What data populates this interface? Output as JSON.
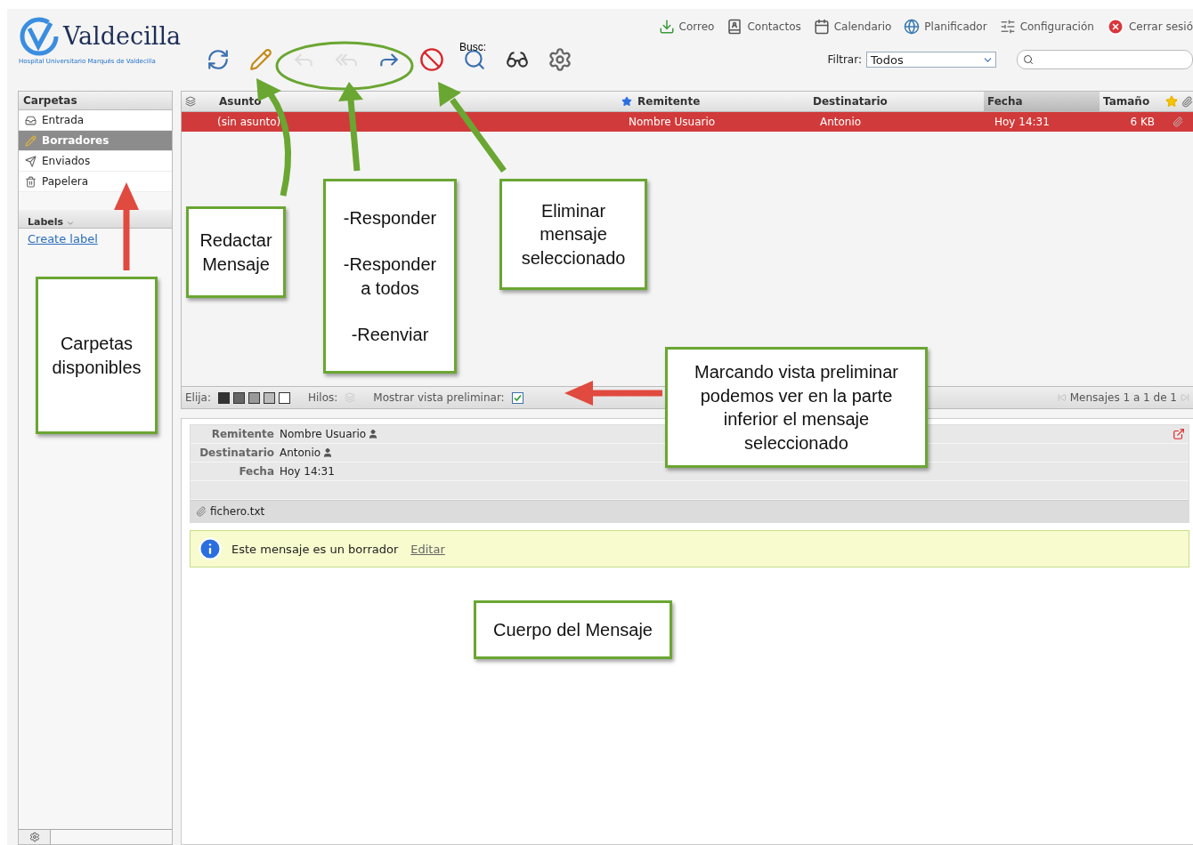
{
  "logo": {
    "name": "Valdecilla",
    "subtitle": "Hospital Universitario Marqués de Valdecilla"
  },
  "top_nav": [
    {
      "label": "Correo",
      "kind": "mail"
    },
    {
      "label": "Contactos",
      "kind": "contacts"
    },
    {
      "label": "Calendario",
      "kind": "calendar"
    },
    {
      "label": "Planificador",
      "kind": "planner"
    },
    {
      "label": "Configuración",
      "kind": "settings"
    },
    {
      "label": "Cerrar sesió",
      "kind": "logout"
    }
  ],
  "toolbar": {
    "buttons": [
      {
        "kind": "refresh",
        "disabled": false
      },
      {
        "kind": "compose",
        "disabled": false
      },
      {
        "kind": "reply",
        "disabled": true
      },
      {
        "kind": "reply_all",
        "disabled": true
      },
      {
        "kind": "forward",
        "disabled": false
      },
      {
        "kind": "delete",
        "disabled": false
      },
      {
        "kind": "search",
        "disabled": false,
        "label": "Busc:"
      },
      {
        "kind": "mark",
        "disabled": false
      },
      {
        "kind": "more",
        "disabled": false
      }
    ],
    "filter_label": "Filtrar:",
    "filter_value": "Todos"
  },
  "folders": {
    "title": "Carpetas",
    "items": [
      {
        "label": "Entrada",
        "kind": "inbox",
        "selected": false
      },
      {
        "label": "Borradores",
        "kind": "drafts",
        "selected": true
      },
      {
        "label": "Enviados",
        "kind": "sent",
        "selected": false
      },
      {
        "label": "Papelera",
        "kind": "trash",
        "selected": false
      }
    ]
  },
  "labels": {
    "title": "Labels",
    "link": "Create label"
  },
  "message_list": {
    "columns": [
      {
        "label": "Asunto",
        "sorted": false
      },
      {
        "label": "Remitente",
        "sorted": false
      },
      {
        "label": "Destinatario",
        "sorted": false
      },
      {
        "label": "Fecha",
        "sorted": true
      },
      {
        "label": "Tamaño",
        "sorted": false
      }
    ],
    "rows": [
      {
        "subject": "(sin asunto)",
        "from": "Nombre Usuario",
        "to": "Antonio",
        "date": "Hoy 14:31",
        "size": "6 KB",
        "selected": true
      }
    ]
  },
  "list_footer": {
    "select_label": "Elija:",
    "threads_label": "Hilos:",
    "preview_label": "Mostrar vista preliminar:",
    "preview_checked": true,
    "pager": "Mensajes 1 a 1 de 1"
  },
  "preview": {
    "headers": [
      {
        "label": "Remitente",
        "value": "Nombre Usuario",
        "contact": true
      },
      {
        "label": "Destinatario",
        "value": "Antonio",
        "contact": true
      },
      {
        "label": "Fecha",
        "value": "Hoy 14:31",
        "contact": false
      }
    ],
    "attachment": "fichero.txt",
    "notice": "Este mensaje es un borrador",
    "notice_link": "Editar"
  },
  "annotations": [
    {
      "paragraphs": [
        [
          "Carpetas",
          "disponibles"
        ]
      ]
    },
    {
      "paragraphs": [
        [
          "Redactar",
          "Mensaje"
        ]
      ]
    },
    {
      "paragraphs": [
        [
          "-Responder"
        ],
        [
          "-Responder",
          "a todos"
        ],
        [
          "-Reenviar"
        ]
      ]
    },
    {
      "paragraphs": [
        [
          "Eliminar",
          "mensaje",
          "seleccionado"
        ]
      ]
    },
    {
      "paragraphs": [
        [
          "Marcando vista preliminar",
          "podemos ver en la parte",
          "inferior el mensaje",
          "seleccionado"
        ]
      ]
    },
    {
      "paragraphs": [
        [
          "Cuerpo del Mensaje"
        ]
      ]
    }
  ]
}
